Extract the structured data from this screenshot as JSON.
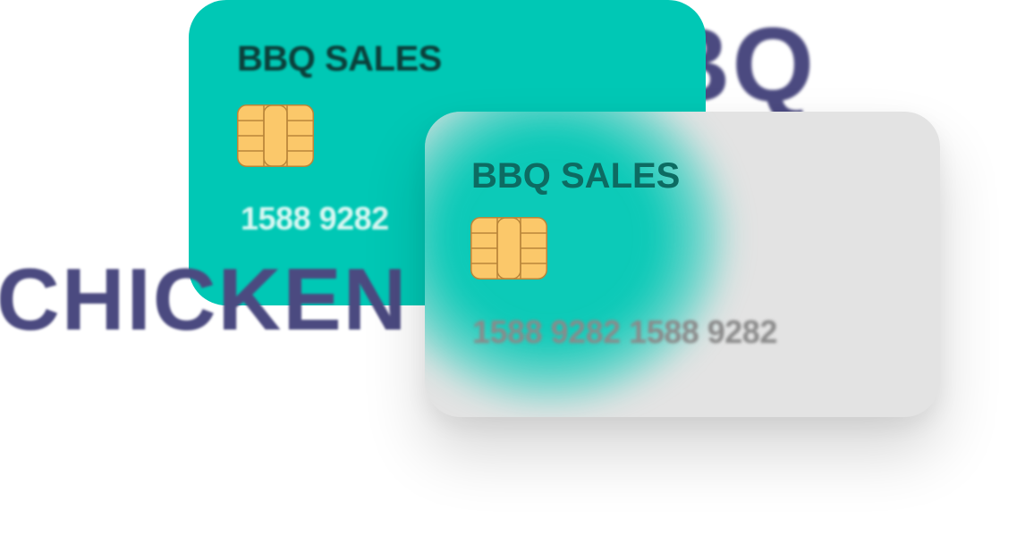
{
  "background": {
    "word_top": "BBQ",
    "word_left": "CHICKEN"
  },
  "back_card": {
    "title": "BBQ SALES",
    "number": "1588 9282"
  },
  "front_card": {
    "title": "BBQ SALES",
    "number": "1588 9282 1588 9282"
  },
  "colors": {
    "accent": "#00c8b5",
    "background_text": "#4b4a80",
    "chip": "#fbc86a",
    "card_surface": "#e3e3e3"
  },
  "icons": [
    "emv-chip-icon",
    "emv-chip-icon"
  ]
}
